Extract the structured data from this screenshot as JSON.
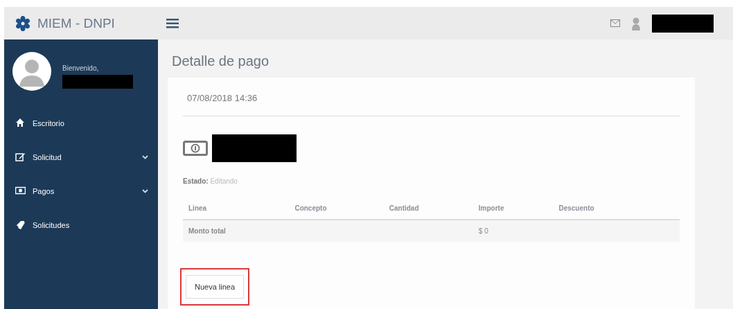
{
  "header": {
    "brand": "MIEM - DNPI"
  },
  "sidebar": {
    "greeting": "Bienvenido,",
    "items": [
      {
        "label": "Escritorio",
        "kind": "home",
        "has_submenu": false
      },
      {
        "label": "Solicitud",
        "kind": "edit",
        "has_submenu": true
      },
      {
        "label": "Pagos",
        "kind": "money",
        "has_submenu": true
      },
      {
        "label": "Solicitudes",
        "kind": "tag",
        "has_submenu": false
      }
    ]
  },
  "page": {
    "title": "Detalle de pago",
    "date": "07/08/2018 14:36",
    "status_label": "Estado:",
    "status_value": "Editando"
  },
  "table": {
    "columns": [
      "Linea",
      "Concepto",
      "Cantidad",
      "Importe",
      "Descuento"
    ],
    "rows": [
      [
        "Monto total",
        "",
        "",
        "$ 0",
        ""
      ]
    ]
  },
  "button": {
    "label": "Nueva linea",
    "highlighted": true
  }
}
